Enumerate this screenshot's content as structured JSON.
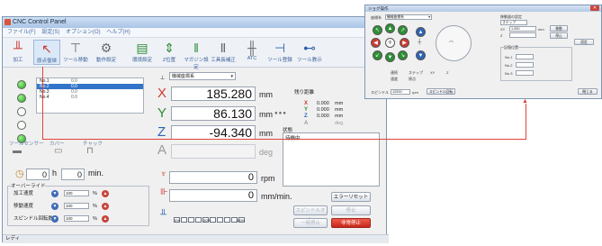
{
  "main_window": {
    "title": "CNC Control Panel",
    "close_glyph": "✕",
    "menu": [
      "ファイル(F)",
      "設定(S)",
      "オプション(O)",
      "ヘルプ(H)"
    ],
    "toolbar": [
      {
        "label": "加工",
        "icon": "machine-icon",
        "glyph": "╨"
      },
      {
        "label": "原点復帰",
        "icon": "origin-return-icon",
        "glyph": "↖"
      },
      {
        "label": "ツール移動",
        "icon": "tool-move-icon",
        "glyph": "⊤"
      },
      {
        "label": "動作設定",
        "icon": "operation-settings-icon",
        "glyph": "⚙"
      },
      {
        "label": "環境設定",
        "icon": "environment-icon",
        "glyph": "▤"
      },
      {
        "label": "Z位置",
        "icon": "z-position-icon",
        "glyph": "⇕"
      },
      {
        "label": "マガジン設定",
        "icon": "magazine-icon",
        "glyph": "‖"
      },
      {
        "label": "工具長補正",
        "icon": "tool-length-icon",
        "glyph": "Ⅱ"
      },
      {
        "label": "ATC",
        "icon": "atc-icon",
        "glyph": "╫"
      },
      {
        "label": "ツール登録",
        "icon": "tool-register-icon",
        "glyph": "⊣"
      },
      {
        "label": "ツール教示",
        "icon": "tool-teach-icon",
        "glyph": "⊷"
      }
    ],
    "origin_list": [
      {
        "label": "No.1",
        "value": "0.0"
      },
      {
        "label": "No.2",
        "value": "0.0"
      },
      {
        "label": "No.3",
        "value": "0.0"
      },
      {
        "label": "No.4",
        "value": "0.0"
      }
    ],
    "coord_select": "機械座標系",
    "x_label": "X",
    "x_value": "185.280",
    "x_unit": "mm",
    "y_label": "Y",
    "y_value": "86.130",
    "y_unit": "mm",
    "z_label": "Z",
    "z_value": "-94.340",
    "z_unit": "mm",
    "a_label": "A",
    "a_unit": "deg",
    "dots": "●●●",
    "remaining_title": "残り距離",
    "remaining": [
      {
        "axis": "X",
        "value": "0.000",
        "unit": "mm"
      },
      {
        "axis": "Y",
        "value": "0.000",
        "unit": "mm"
      },
      {
        "axis": "Z",
        "value": "0.000",
        "unit": "mm"
      },
      {
        "axis": "A",
        "value": "",
        "unit": "deg"
      }
    ],
    "tool_labels": [
      "ツールセンサー",
      "カバー",
      "チャック"
    ],
    "time_h_value": "0",
    "time_h_unit": "h",
    "time_m_value": "0",
    "time_m_unit": "min.",
    "override_title": "オーバーライド",
    "overrides": [
      {
        "label": "加工速度",
        "value": "100",
        "pct": "%"
      },
      {
        "label": "移動速度",
        "value": "100",
        "pct": "%"
      },
      {
        "label": "スピンドル回転数",
        "value": "100",
        "pct": "%"
      }
    ],
    "spindle_value": "0",
    "spindle_unit": "rpm",
    "feed_value": "0",
    "feed_unit": "mm/min.",
    "status_title": "状態",
    "status_text": "待機中",
    "btn_error": "エラーリセット",
    "btn_spindle": "スピンドルオン",
    "btn_pause": "一時停止",
    "btn_stop": "停止",
    "btn_emergency": "非常停止",
    "progress_ticks": [
      "0%",
      "50%",
      "100%"
    ],
    "status_bar": "レディ"
  },
  "popup_window": {
    "title": "ジョグ操作",
    "close_glyph": "✕",
    "coord_select": "機械座標系",
    "step_title": "移動量の設定",
    "step_mode": "ステップ",
    "xy_label": "XY",
    "z_label": "Z",
    "speed_label": "速度",
    "speed_value": "1.000",
    "speed_unit": "mm",
    "move_btn": "移動",
    "stop_btn": "停止",
    "setting_btn": "設定",
    "origin_btn": "原点",
    "memory_title": "記憶位置",
    "memory_rows": [
      "No.1",
      "No.2",
      "No.3"
    ],
    "continuous": "連続",
    "step": "ステップ",
    "spindle_label": "スピンドル",
    "spindle_value": "12000",
    "spindle_unit": "rpm",
    "spindle_btn": "スピンドル回転",
    "close_btn": "閉じる"
  }
}
